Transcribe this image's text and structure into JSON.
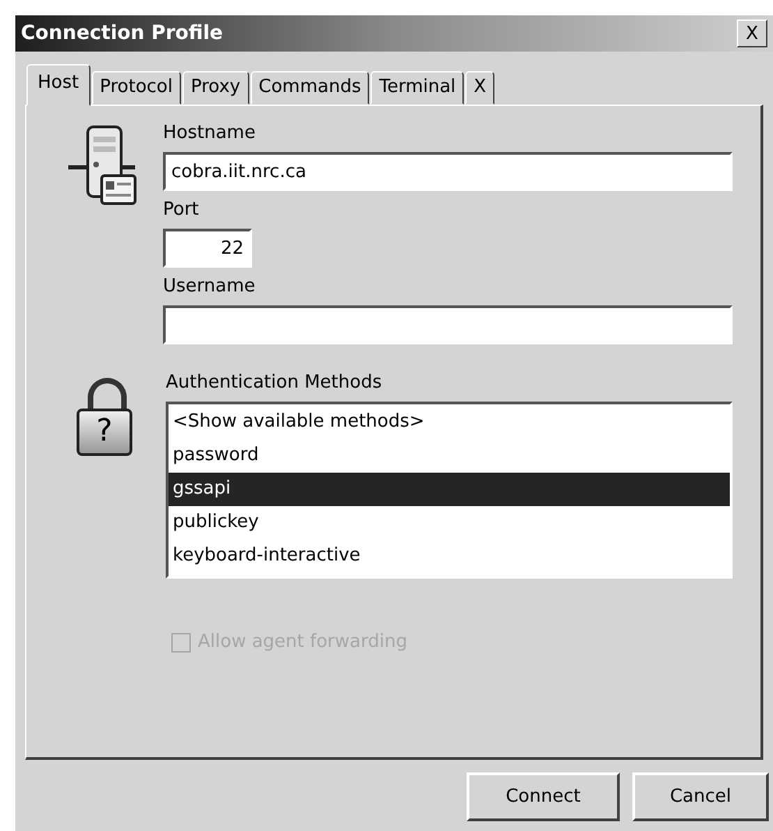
{
  "window": {
    "title": "Connection Profile",
    "close": "X"
  },
  "tabs": [
    {
      "label": "Host",
      "selected": true
    },
    {
      "label": "Protocol",
      "selected": false
    },
    {
      "label": "Proxy",
      "selected": false
    },
    {
      "label": "Commands",
      "selected": false
    },
    {
      "label": "Terminal",
      "selected": false
    },
    {
      "label": "X",
      "selected": false
    }
  ],
  "hostname": {
    "label": "Hostname",
    "value": "cobra.iit.nrc.ca"
  },
  "port": {
    "label": "Port",
    "value": "22"
  },
  "username": {
    "label": "Username"
  },
  "auth": {
    "label": "Authentication Methods",
    "lock_mark": "?",
    "items": [
      {
        "label": "<Show available methods>",
        "selected": false
      },
      {
        "label": "password",
        "selected": false
      },
      {
        "label": "gssapi",
        "selected": true
      },
      {
        "label": "publickey",
        "selected": false
      },
      {
        "label": "keyboard-interactive",
        "selected": false
      }
    ]
  },
  "agent_forwarding": {
    "label": "Allow agent forwarding",
    "checked": false,
    "disabled": true
  },
  "buttons": [
    "Connect",
    "Cancel"
  ]
}
